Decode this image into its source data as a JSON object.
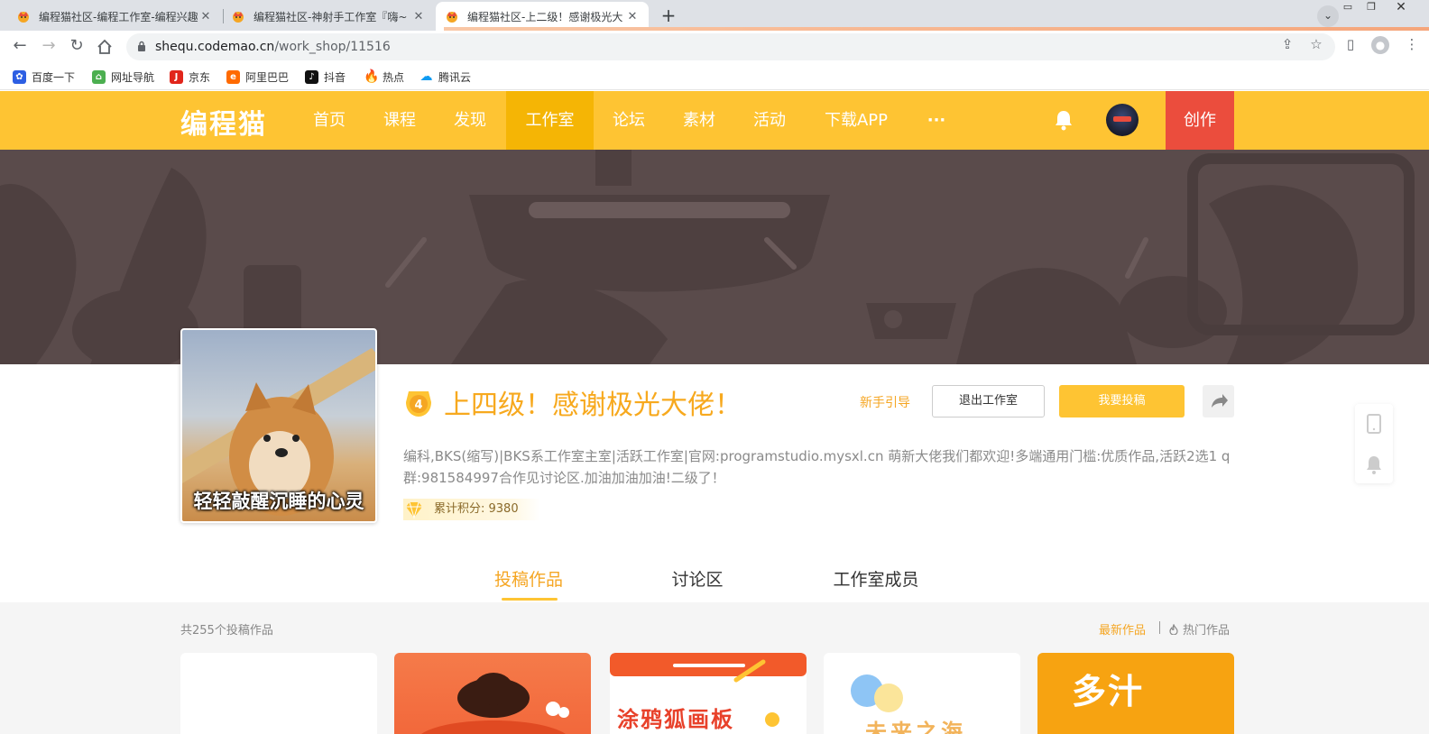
{
  "browser": {
    "tabs": [
      {
        "title": "编程猫社区-编程工作室-编程兴趣"
      },
      {
        "title": "编程猫社区-神射手工作室『嗨~"
      },
      {
        "title": "编程猫社区-上二级！感谢极光大"
      }
    ],
    "url_host": "shequ.codemao.cn",
    "url_path": "/work_shop/11516",
    "bookmarks": [
      "百度一下",
      "网址导航",
      "京东",
      "阿里巴巴",
      "抖音",
      "热点",
      "腾讯云"
    ]
  },
  "site": {
    "logo": "编程猫",
    "nav": [
      "首页",
      "课程",
      "发现",
      "工作室",
      "论坛",
      "素材",
      "活动",
      "下载APP",
      "···"
    ],
    "create_label": "创作"
  },
  "studio": {
    "cover_caption": "轻轻敲醒沉睡的心灵",
    "level": "4",
    "name": "上四级！感谢极光大佬！",
    "guide_label": "新手引导",
    "quit_label": "退出工作室",
    "submit_label": "我要投稿",
    "description": "编科,BKS(缩写)|BKS系工作室主室|活跃工作室|官网:programstudio.mysxl.cn 萌新大佬我们都欢迎!多端通用门槛:优质作品,活跃2选1 q群:981584997合作见讨论区.加油加油加油!二级了！",
    "points_label": "累计积分: 9380"
  },
  "tabs": [
    "投稿作品",
    "讨论区",
    "工作室成员"
  ],
  "works": {
    "count_label": "共255个投稿作品",
    "sort_new": "最新作品",
    "sort_hot": "热门作品",
    "card_texts": [
      "涂鸦狐画板",
      "未来之海",
      "多汁"
    ]
  },
  "colors": {
    "brand_yellow": "#fec433",
    "active_nav": "#f5b505",
    "create_red": "#eb4d3d",
    "accent_orange": "#f5a623",
    "banner_brown": "#5a4b4b"
  }
}
